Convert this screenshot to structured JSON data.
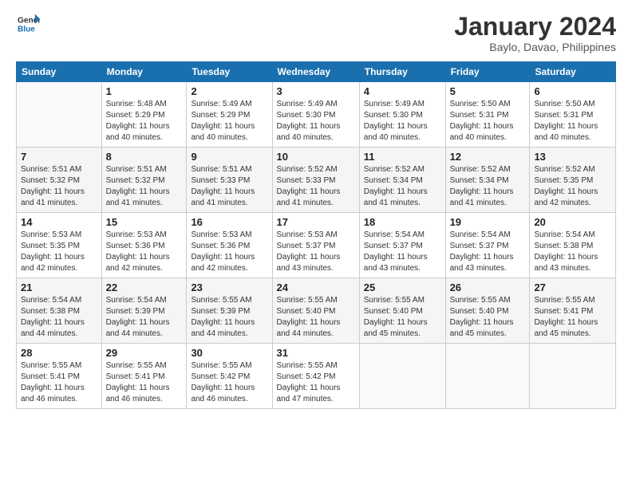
{
  "logo": {
    "line1": "General",
    "line2": "Blue"
  },
  "title": "January 2024",
  "subtitle": "Baylo, Davao, Philippines",
  "days": [
    "Sunday",
    "Monday",
    "Tuesday",
    "Wednesday",
    "Thursday",
    "Friday",
    "Saturday"
  ],
  "weeks": [
    [
      {
        "num": "",
        "sunrise": "",
        "sunset": "",
        "daylight": ""
      },
      {
        "num": "1",
        "sunrise": "Sunrise: 5:48 AM",
        "sunset": "Sunset: 5:29 PM",
        "daylight": "Daylight: 11 hours and 40 minutes."
      },
      {
        "num": "2",
        "sunrise": "Sunrise: 5:49 AM",
        "sunset": "Sunset: 5:29 PM",
        "daylight": "Daylight: 11 hours and 40 minutes."
      },
      {
        "num": "3",
        "sunrise": "Sunrise: 5:49 AM",
        "sunset": "Sunset: 5:30 PM",
        "daylight": "Daylight: 11 hours and 40 minutes."
      },
      {
        "num": "4",
        "sunrise": "Sunrise: 5:49 AM",
        "sunset": "Sunset: 5:30 PM",
        "daylight": "Daylight: 11 hours and 40 minutes."
      },
      {
        "num": "5",
        "sunrise": "Sunrise: 5:50 AM",
        "sunset": "Sunset: 5:31 PM",
        "daylight": "Daylight: 11 hours and 40 minutes."
      },
      {
        "num": "6",
        "sunrise": "Sunrise: 5:50 AM",
        "sunset": "Sunset: 5:31 PM",
        "daylight": "Daylight: 11 hours and 40 minutes."
      }
    ],
    [
      {
        "num": "7",
        "sunrise": "Sunrise: 5:51 AM",
        "sunset": "Sunset: 5:32 PM",
        "daylight": "Daylight: 11 hours and 41 minutes."
      },
      {
        "num": "8",
        "sunrise": "Sunrise: 5:51 AM",
        "sunset": "Sunset: 5:32 PM",
        "daylight": "Daylight: 11 hours and 41 minutes."
      },
      {
        "num": "9",
        "sunrise": "Sunrise: 5:51 AM",
        "sunset": "Sunset: 5:33 PM",
        "daylight": "Daylight: 11 hours and 41 minutes."
      },
      {
        "num": "10",
        "sunrise": "Sunrise: 5:52 AM",
        "sunset": "Sunset: 5:33 PM",
        "daylight": "Daylight: 11 hours and 41 minutes."
      },
      {
        "num": "11",
        "sunrise": "Sunrise: 5:52 AM",
        "sunset": "Sunset: 5:34 PM",
        "daylight": "Daylight: 11 hours and 41 minutes."
      },
      {
        "num": "12",
        "sunrise": "Sunrise: 5:52 AM",
        "sunset": "Sunset: 5:34 PM",
        "daylight": "Daylight: 11 hours and 41 minutes."
      },
      {
        "num": "13",
        "sunrise": "Sunrise: 5:52 AM",
        "sunset": "Sunset: 5:35 PM",
        "daylight": "Daylight: 11 hours and 42 minutes."
      }
    ],
    [
      {
        "num": "14",
        "sunrise": "Sunrise: 5:53 AM",
        "sunset": "Sunset: 5:35 PM",
        "daylight": "Daylight: 11 hours and 42 minutes."
      },
      {
        "num": "15",
        "sunrise": "Sunrise: 5:53 AM",
        "sunset": "Sunset: 5:36 PM",
        "daylight": "Daylight: 11 hours and 42 minutes."
      },
      {
        "num": "16",
        "sunrise": "Sunrise: 5:53 AM",
        "sunset": "Sunset: 5:36 PM",
        "daylight": "Daylight: 11 hours and 42 minutes."
      },
      {
        "num": "17",
        "sunrise": "Sunrise: 5:53 AM",
        "sunset": "Sunset: 5:37 PM",
        "daylight": "Daylight: 11 hours and 43 minutes."
      },
      {
        "num": "18",
        "sunrise": "Sunrise: 5:54 AM",
        "sunset": "Sunset: 5:37 PM",
        "daylight": "Daylight: 11 hours and 43 minutes."
      },
      {
        "num": "19",
        "sunrise": "Sunrise: 5:54 AM",
        "sunset": "Sunset: 5:37 PM",
        "daylight": "Daylight: 11 hours and 43 minutes."
      },
      {
        "num": "20",
        "sunrise": "Sunrise: 5:54 AM",
        "sunset": "Sunset: 5:38 PM",
        "daylight": "Daylight: 11 hours and 43 minutes."
      }
    ],
    [
      {
        "num": "21",
        "sunrise": "Sunrise: 5:54 AM",
        "sunset": "Sunset: 5:38 PM",
        "daylight": "Daylight: 11 hours and 44 minutes."
      },
      {
        "num": "22",
        "sunrise": "Sunrise: 5:54 AM",
        "sunset": "Sunset: 5:39 PM",
        "daylight": "Daylight: 11 hours and 44 minutes."
      },
      {
        "num": "23",
        "sunrise": "Sunrise: 5:55 AM",
        "sunset": "Sunset: 5:39 PM",
        "daylight": "Daylight: 11 hours and 44 minutes."
      },
      {
        "num": "24",
        "sunrise": "Sunrise: 5:55 AM",
        "sunset": "Sunset: 5:40 PM",
        "daylight": "Daylight: 11 hours and 44 minutes."
      },
      {
        "num": "25",
        "sunrise": "Sunrise: 5:55 AM",
        "sunset": "Sunset: 5:40 PM",
        "daylight": "Daylight: 11 hours and 45 minutes."
      },
      {
        "num": "26",
        "sunrise": "Sunrise: 5:55 AM",
        "sunset": "Sunset: 5:40 PM",
        "daylight": "Daylight: 11 hours and 45 minutes."
      },
      {
        "num": "27",
        "sunrise": "Sunrise: 5:55 AM",
        "sunset": "Sunset: 5:41 PM",
        "daylight": "Daylight: 11 hours and 45 minutes."
      }
    ],
    [
      {
        "num": "28",
        "sunrise": "Sunrise: 5:55 AM",
        "sunset": "Sunset: 5:41 PM",
        "daylight": "Daylight: 11 hours and 46 minutes."
      },
      {
        "num": "29",
        "sunrise": "Sunrise: 5:55 AM",
        "sunset": "Sunset: 5:41 PM",
        "daylight": "Daylight: 11 hours and 46 minutes."
      },
      {
        "num": "30",
        "sunrise": "Sunrise: 5:55 AM",
        "sunset": "Sunset: 5:42 PM",
        "daylight": "Daylight: 11 hours and 46 minutes."
      },
      {
        "num": "31",
        "sunrise": "Sunrise: 5:55 AM",
        "sunset": "Sunset: 5:42 PM",
        "daylight": "Daylight: 11 hours and 47 minutes."
      },
      {
        "num": "",
        "sunrise": "",
        "sunset": "",
        "daylight": ""
      },
      {
        "num": "",
        "sunrise": "",
        "sunset": "",
        "daylight": ""
      },
      {
        "num": "",
        "sunrise": "",
        "sunset": "",
        "daylight": ""
      }
    ]
  ]
}
